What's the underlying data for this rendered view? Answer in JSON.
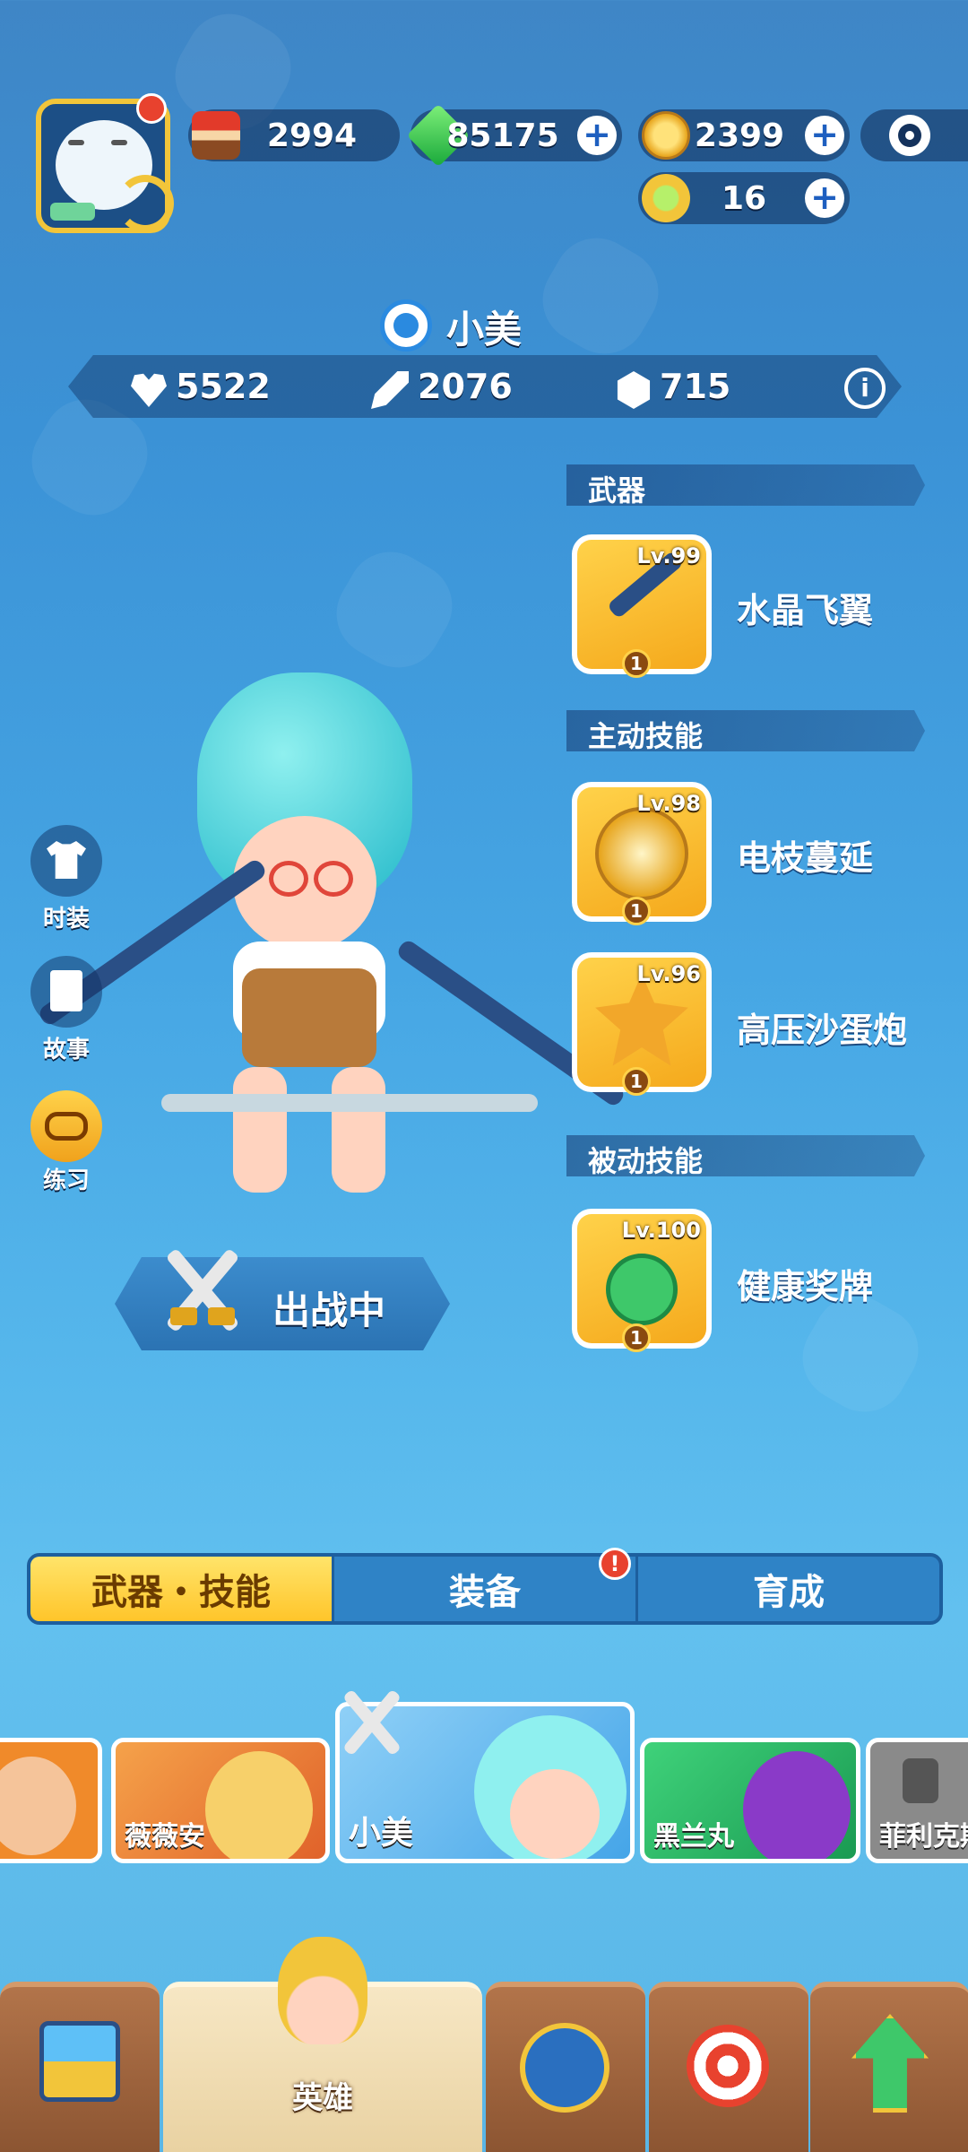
{
  "currencies": [
    {
      "name": "cake",
      "value": "2994",
      "has_plus": false
    },
    {
      "name": "gem",
      "value": "85175",
      "has_plus": true
    },
    {
      "name": "coin",
      "value": "2399",
      "has_plus": true
    },
    {
      "name": "token",
      "value": "16",
      "has_plus": true
    }
  ],
  "hero": {
    "name": "小美",
    "stats": {
      "hp": "5522",
      "attack": "2076",
      "defense": "715"
    }
  },
  "sections": {
    "weapon": {
      "header": "武器",
      "items": [
        {
          "level": "Lv.99",
          "name": "水晶飞翼",
          "badge": "1"
        }
      ]
    },
    "active": {
      "header": "主动技能",
      "items": [
        {
          "level": "Lv.98",
          "name": "电枝蔓延",
          "badge": "1"
        },
        {
          "level": "Lv.96",
          "name": "高压沙蛋炮",
          "badge": "1"
        }
      ]
    },
    "passive": {
      "header": "被动技能",
      "items": [
        {
          "level": "Lv.100",
          "name": "健康奖牌",
          "badge": "1"
        }
      ]
    }
  },
  "side_buttons": [
    {
      "label": "时装",
      "icon": "shirt-icon"
    },
    {
      "label": "故事",
      "icon": "story-icon"
    },
    {
      "label": "练习",
      "icon": "gamepad-icon"
    }
  ],
  "battle_button": {
    "label": "出战中"
  },
  "tabs": [
    {
      "label": "武器・技能",
      "active": true
    },
    {
      "label": "装备",
      "active": false,
      "alert": "!"
    },
    {
      "label": "育成",
      "active": false
    }
  ],
  "hero_cards": [
    {
      "name": "",
      "color": "#f08a2a"
    },
    {
      "name": "薇薇安",
      "color": "#f07d2a"
    },
    {
      "name": "小美",
      "color": "#58b6f0",
      "selected": true
    },
    {
      "name": "黑兰丸",
      "color": "#2eb86a"
    },
    {
      "name": "菲利克斯",
      "color": "#8a8a8a",
      "locked": true
    }
  ],
  "bottom_nav": [
    {
      "label": "",
      "icon": "shop-icon"
    },
    {
      "label": "英雄",
      "icon": "hero-icon",
      "active": true
    },
    {
      "label": "",
      "icon": "battle-icon"
    },
    {
      "label": "",
      "icon": "target-icon"
    },
    {
      "label": "",
      "icon": "upgrade-icon"
    }
  ]
}
